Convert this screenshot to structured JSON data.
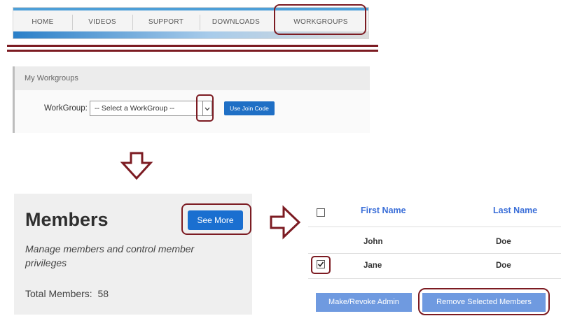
{
  "nav": {
    "items": [
      "HOME",
      "VIDEOS",
      "SUPPORT",
      "DOWNLOADS",
      "WORKGROUPS"
    ]
  },
  "workgroups": {
    "title": "My Workgroups",
    "label": "WorkGroup:",
    "select_value": "-- Select a WorkGroup --",
    "join_button": "Use Join Code"
  },
  "members": {
    "title": "Members",
    "description": "Manage members and control member privileges",
    "total_label": "Total Members:",
    "total_value": "58",
    "see_more": "See More"
  },
  "table": {
    "headers": [
      "First Name",
      "Last Name"
    ],
    "rows": [
      {
        "first": "John",
        "last": "Doe",
        "checked": false
      },
      {
        "first": "Jane",
        "last": "Doe",
        "checked": true
      }
    ],
    "make_admin": "Make/Revoke Admin",
    "remove": "Remove Selected Members"
  },
  "colors": {
    "highlight": "#7c1b22",
    "primary": "#1f6fc5",
    "header_text": "#3a6ed8"
  },
  "icons": {
    "step_down": "arrow-down-icon",
    "step_right": "arrow-right-icon",
    "dropdown": "chevron-down-icon",
    "checkmark": "checkmark-icon"
  }
}
